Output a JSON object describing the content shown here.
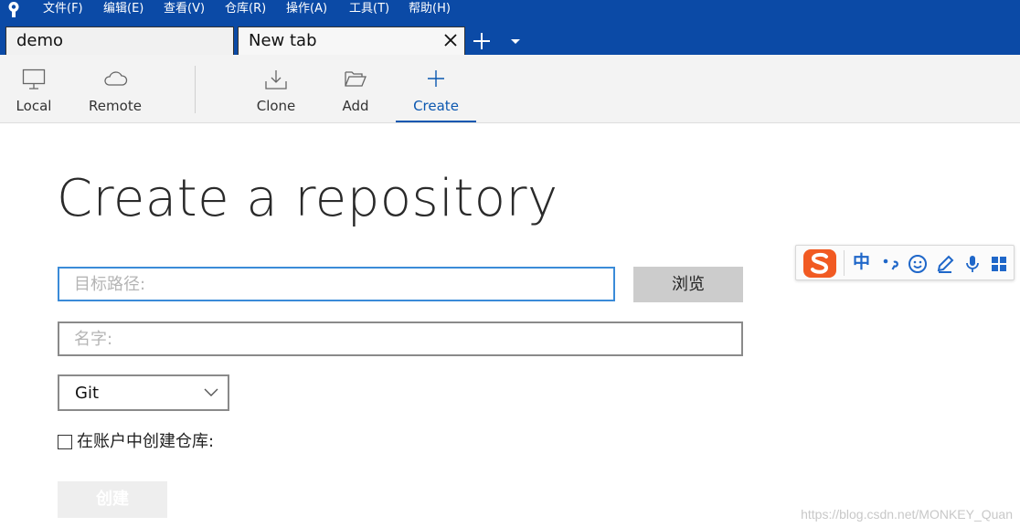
{
  "menu": {
    "items": [
      "文件(F)",
      "编辑(E)",
      "查看(V)",
      "仓库(R)",
      "操作(A)",
      "工具(T)",
      "帮助(H)"
    ]
  },
  "tabs": [
    {
      "label": "demo",
      "active": false
    },
    {
      "label": "New tab",
      "active": true
    }
  ],
  "toolbar": {
    "local_label": "Local",
    "remote_label": "Remote",
    "clone_label": "Clone",
    "add_label": "Add",
    "create_label": "Create",
    "active_tab": "Create"
  },
  "main": {
    "title": "Create a repository",
    "path_placeholder": "目标路径:",
    "browse_label": "浏览",
    "name_placeholder": "名字:",
    "vcs_selected": "Git",
    "create_in_account_label": "在账户中创建仓库:",
    "create_in_account_checked": false,
    "create_button_label": "创建"
  },
  "ime": {
    "language": "中",
    "icons": [
      "sogou-logo-icon",
      "punctuation-icon",
      "emoji-icon",
      "skin-icon",
      "microphone-icon",
      "toolbox-icon"
    ]
  },
  "watermark": "https://blog.csdn.net/MONKEY_Quan",
  "colors": {
    "brand_blue": "#0b4aa6",
    "accent": "#0b57b0",
    "focus_border": "#3a8bd8"
  }
}
